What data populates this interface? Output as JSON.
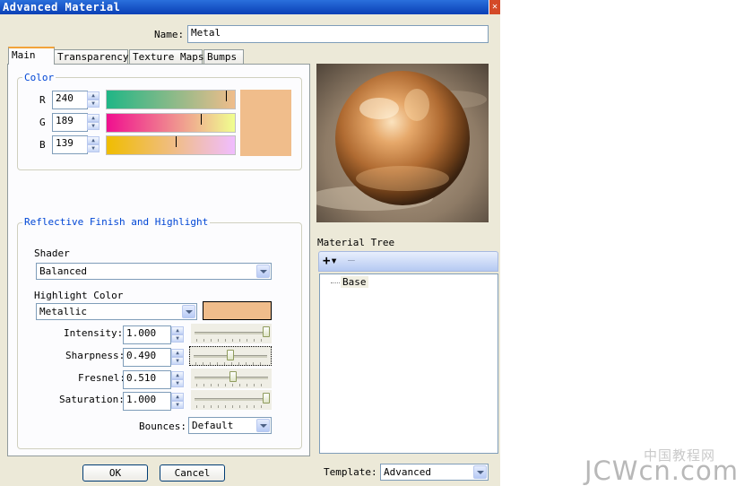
{
  "window": {
    "title": "Advanced Material",
    "close_glyph": "✕"
  },
  "name": {
    "label": "Name:",
    "value": "Metal"
  },
  "tabs": [
    {
      "label": "Main",
      "active": true
    },
    {
      "label": "Transparency",
      "active": false
    },
    {
      "label": "Texture Maps",
      "active": false
    },
    {
      "label": "Bumps",
      "active": false
    }
  ],
  "color": {
    "group_title": "Color",
    "r": {
      "label": "R",
      "value": "240",
      "level": 240
    },
    "g": {
      "label": "G",
      "value": "189",
      "level": 189
    },
    "b": {
      "label": "B",
      "value": "139",
      "level": 139
    },
    "swatch": "#f0bd8b"
  },
  "reflective": {
    "group_title": "Reflective Finish and Highlight",
    "shader_label": "Shader",
    "shader_value": "Balanced",
    "highlight_color_label": "Highlight Color",
    "highlight_value": "Metallic",
    "highlight_swatch": "#f0bd8b",
    "params": [
      {
        "label": "Intensity:",
        "value": "1.000",
        "level": 1.0
      },
      {
        "label": "Sharpness:",
        "value": "0.490",
        "level": 0.49
      },
      {
        "label": "Fresnel:",
        "value": "0.510",
        "level": 0.51
      },
      {
        "label": "Saturation:",
        "value": "1.000",
        "level": 1.0
      }
    ],
    "bounces_label": "Bounces:",
    "bounces_value": "Default"
  },
  "material_tree": {
    "label": "Material Tree",
    "add_glyph": "+▾",
    "remove_glyph": "—",
    "items": [
      "Base"
    ]
  },
  "buttons": {
    "ok": "OK",
    "cancel": "Cancel"
  },
  "template": {
    "label": "Template:",
    "value": "Advanced"
  },
  "watermark": {
    "top": "中国教程网",
    "bottom": "JCWcn.com"
  }
}
